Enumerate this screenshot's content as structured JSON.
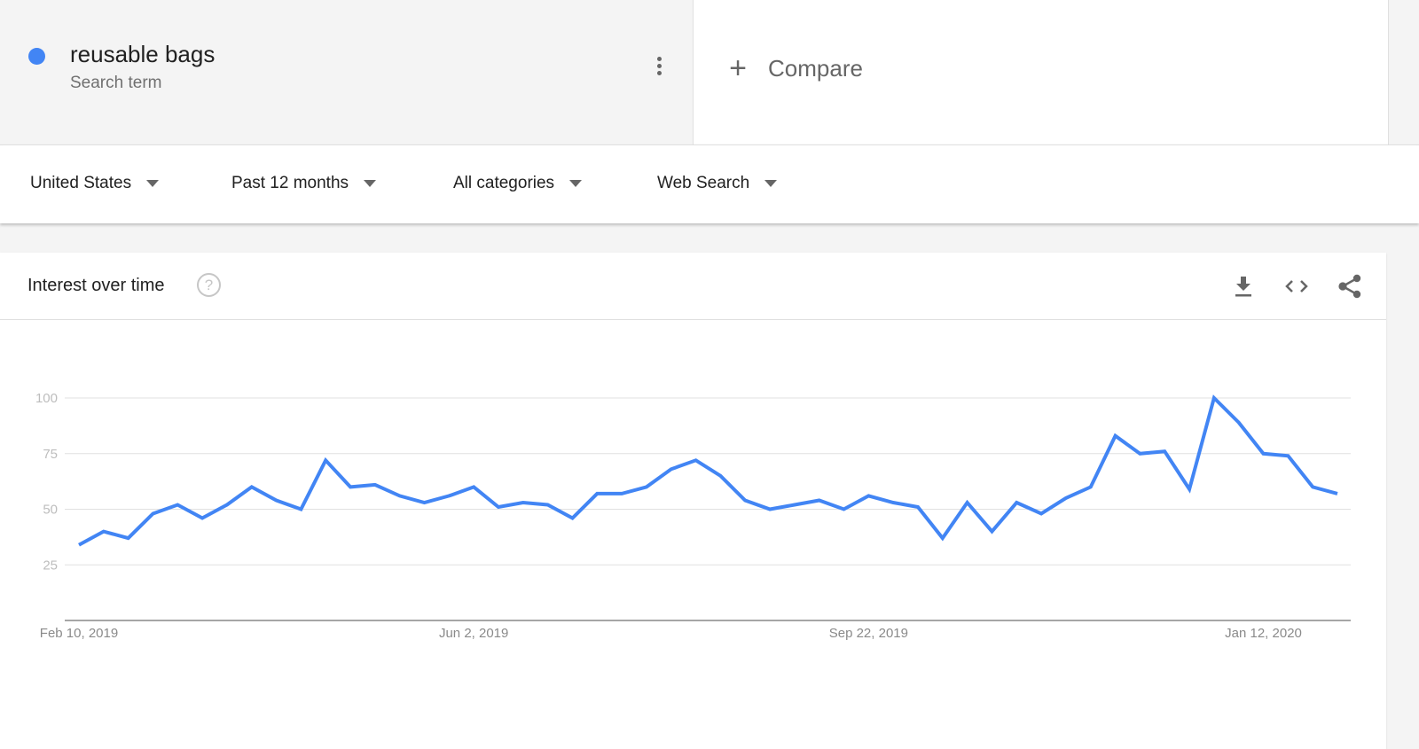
{
  "term": {
    "name": "reusable bags",
    "subtitle": "Search term",
    "color": "#4285f4"
  },
  "compare": {
    "label": "Compare"
  },
  "filters": [
    {
      "label": "United States"
    },
    {
      "label": "Past 12 months"
    },
    {
      "label": "All categories"
    },
    {
      "label": "Web Search"
    }
  ],
  "chart_card": {
    "title": "Interest over time",
    "tools": [
      "download-icon",
      "embed-icon",
      "share-icon"
    ]
  },
  "chart_data": {
    "type": "line",
    "title": "Interest over time",
    "xlabel": "",
    "ylabel": "",
    "ylim": [
      0,
      100
    ],
    "yticks": [
      25,
      50,
      75,
      100
    ],
    "xtick_labels": [
      {
        "label": "Feb 10, 2019",
        "index": 0
      },
      {
        "label": "Jun 2, 2019",
        "index": 16
      },
      {
        "label": "Sep 22, 2019",
        "index": 32
      },
      {
        "label": "Jan 12, 2020",
        "index": 48
      }
    ],
    "grid": true,
    "legend": "none",
    "series": [
      {
        "name": "reusable bags",
        "color": "#4285f4",
        "values": [
          34,
          40,
          37,
          48,
          52,
          46,
          52,
          60,
          54,
          50,
          72,
          60,
          61,
          56,
          53,
          56,
          60,
          51,
          53,
          52,
          46,
          57,
          57,
          60,
          68,
          72,
          65,
          54,
          50,
          52,
          54,
          50,
          56,
          53,
          51,
          37,
          53,
          40,
          53,
          48,
          55,
          60,
          83,
          75,
          76,
          59,
          100,
          89,
          75,
          74,
          60,
          57
        ]
      }
    ]
  }
}
